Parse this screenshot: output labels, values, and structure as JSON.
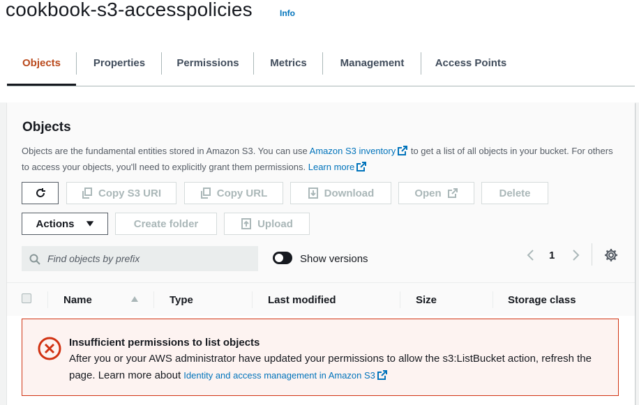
{
  "header": {
    "bucket_name": "cookbook-s3-accesspolicies",
    "info_link": "Info"
  },
  "tabs": [
    {
      "label": "Objects",
      "active": true
    },
    {
      "label": "Properties"
    },
    {
      "label": "Permissions"
    },
    {
      "label": "Metrics"
    },
    {
      "label": "Management"
    },
    {
      "label": "Access Points"
    }
  ],
  "objects": {
    "title": "Objects",
    "desc_part1": "Objects are the fundamental entities stored in Amazon S3. You can use ",
    "desc_link1": "Amazon S3 inventory",
    "desc_part2": " to get a list of all objects in your bucket. For others to access your objects, you'll need to explicitly grant them permissions. ",
    "desc_link2": "Learn more"
  },
  "toolbar": {
    "copy_s3_uri": "Copy S3 URI",
    "copy_url": "Copy URL",
    "download": "Download",
    "open": "Open",
    "delete": "Delete",
    "actions": "Actions",
    "create_folder": "Create folder",
    "upload": "Upload"
  },
  "search": {
    "placeholder": "Find objects by prefix"
  },
  "show_versions": {
    "label": "Show versions",
    "enabled": false
  },
  "pagination": {
    "current_page": "1"
  },
  "table": {
    "columns": [
      "Name",
      "Type",
      "Last modified",
      "Size",
      "Storage class"
    ]
  },
  "alert": {
    "title": "Insufficient permissions to list objects",
    "body": "After you or your AWS administrator have updated your permissions to allow the s3:ListBucket action, refresh the page. Learn more about ",
    "link": "Identity and access management in Amazon S3"
  },
  "colors": {
    "active_tab": "#ba4a1d",
    "link": "#0073bb",
    "error": "#d13212",
    "error_bg": "#fdf3f1"
  },
  "icons": [
    "refresh-icon",
    "copy-icon",
    "download-icon",
    "external-link-icon",
    "caret-down-icon",
    "upload-icon",
    "search-icon",
    "chevron-left-icon",
    "chevron-right-icon",
    "gear-icon",
    "sort-icon",
    "error-icon"
  ]
}
